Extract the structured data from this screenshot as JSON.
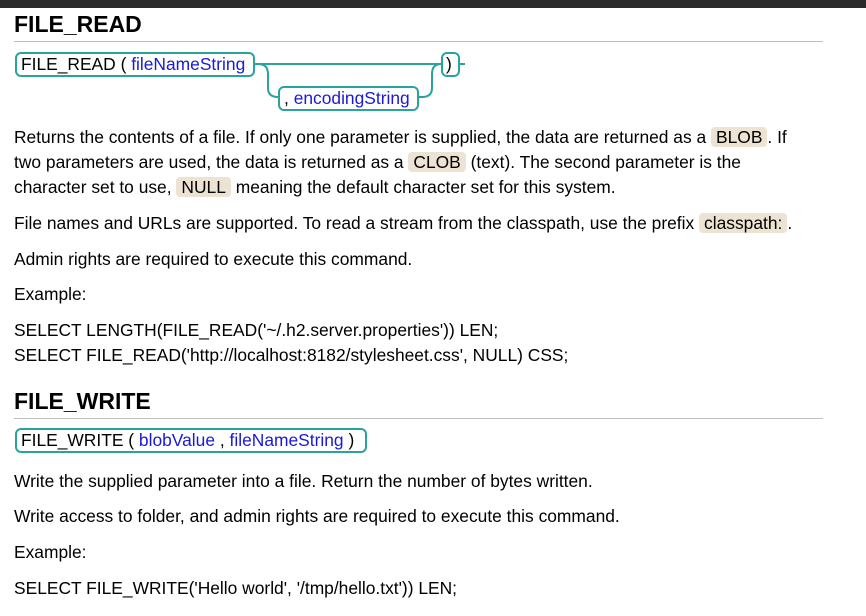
{
  "file_read": {
    "heading": "FILE_READ",
    "syntax": {
      "func": "FILE_READ",
      "open": "(",
      "param1": "fileNameString",
      "comma": ",",
      "param2": "encodingString",
      "close": ")"
    },
    "desc1": {
      "l1a": "Returns the contents of a file. If only one parameter is supplied, the data are returned as a",
      "blob": "BLOB",
      "l1b": ". If",
      "l2a": "two parameters are used, the data is returned as a",
      "clob": "CLOB",
      "l2b": "(text). The second parameter is the",
      "l3a": "character set to use,",
      "null": "NULL",
      "l3b": "meaning the default character set for this system."
    },
    "desc2": {
      "a": "File names and URLs are supported. To read a stream from the classpath, use the prefix",
      "prefix": "classpath:",
      "b": "."
    },
    "admin": "Admin rights are required to execute this command.",
    "example_label": "Example:",
    "examples": [
      "SELECT LENGTH(FILE_READ('~/.h2.server.properties')) LEN;",
      "SELECT FILE_READ('http://localhost:8182/stylesheet.css', NULL) CSS;"
    ]
  },
  "file_write": {
    "heading": "FILE_WRITE",
    "syntax": {
      "func": "FILE_WRITE",
      "open": "(",
      "param1": "blobValue",
      "comma": ",",
      "param2": "fileNameString",
      "close": ")"
    },
    "desc1": "Write the supplied parameter into a file. Return the number of bytes written.",
    "desc2": "Write access to folder, and admin rights are required to execute this command.",
    "example_label": "Example:",
    "examples": [
      "SELECT FILE_WRITE('Hello world', '/tmp/hello.txt')) LEN;"
    ]
  },
  "colors": {
    "rail": "#2aa39c",
    "param": "#1a1ad6",
    "code_bg": "#ede3d3"
  }
}
